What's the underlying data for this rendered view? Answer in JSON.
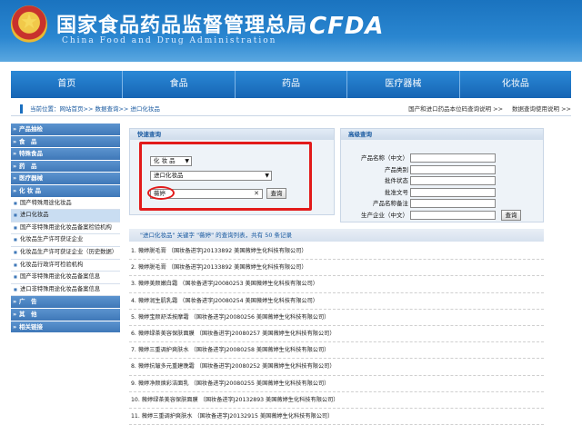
{
  "header": {
    "title": "国家食品药品监督管理总局",
    "subtitle": "China Food and Drug Administration",
    "logo_text": "CFDA",
    "emblem_icon": "national-emblem-icon"
  },
  "nav": [
    "首页",
    "食品",
    "药品",
    "医疗器械",
    "化妆品"
  ],
  "breadcrumb": {
    "text": "当前位置：网站首页>> 数据查询>> 进口化妆品",
    "links": [
      "国产和进口药品本位码查询说明 >>",
      "数据查询使用说明 >>"
    ]
  },
  "sidebar": {
    "categories_top": [
      "产品抽检",
      "食　品",
      "特殊食品",
      "药　品",
      "医疗器械",
      "化 妆 品"
    ],
    "sub_items": [
      {
        "label": "国产特殊用途化妆品",
        "active": false
      },
      {
        "label": "进口化妆品",
        "active": true
      },
      {
        "label": "国产非特殊用途化妆品备案检验机构",
        "active": false
      },
      {
        "label": "化妆品生产许可获证企业",
        "active": false
      },
      {
        "label": "化妆品生产许可获证企业（历史数据）",
        "active": false
      },
      {
        "label": "化妆品行政许可检验机构",
        "active": false
      },
      {
        "label": "国产非特殊用途化妆品备案信息",
        "active": false
      },
      {
        "label": "进口非特殊用途化妆品备案信息",
        "active": false
      }
    ],
    "categories_bottom": [
      "广　告",
      "其　他",
      "相关链接"
    ]
  },
  "quick_search": {
    "title": "快速查询",
    "select1": "化 妆 品",
    "select2": "进口化妆品",
    "input_value": "薇婷",
    "button": "查询"
  },
  "advanced_search": {
    "title": "高级查询",
    "fields": [
      "产品名称（中文）",
      "产品类别",
      "批件状态",
      "批准文号",
      "产品名称备注",
      "生产企业（中文）"
    ],
    "button": "查询"
  },
  "results": {
    "header": "\"进口化妆品\" 关键字 \"薇婷\" 的查询列表，共有 50 条记录",
    "rows": [
      "1. 薇婷脱毛膏 （国妆备进字J20133892 美国薇婷生化科技有限公司）",
      "2. 薇婷脱毛膏 （国妆备进字J20133892 美国薇婷生化科技有限公司）",
      "3. 薇婷美颜嫩白霜 （国妆备进字J20080253 美国薇婷生化科技有限公司）",
      "4. 薇婷润生肌乳霜 （国妆备进字J20080254 美国薇婷生化科技有限公司）",
      "5. 薇婷宝颜舒活按摩霜 （国妆备进字J20080256 美国薇婷生化科技有限公司）",
      "6. 薇婷绿茶美容保肤面膜 （国妆备进字J20080257 美国薇婷生化科技有限公司）",
      "7. 薇婷三重调护爽肤水 （国妆备进字J20080258 美国薇婷生化科技有限公司）",
      "8. 薇婷抗皱多元重建晚霜 （国妆备进字J20080252 美国薇婷生化科技有限公司）",
      "9. 薇婷净颜焕彩洁面乳 （国妆备进字J20080255 美国薇婷生化科技有限公司）",
      "10. 薇婷绿茶美容保肤面膜 （国妆备进字J20132893 美国薇婷生化科技有限公司）",
      "11. 薇婷三重调护爽肤水 （国妆备进字J20132915 美国薇婷生化科技有限公司）"
    ]
  },
  "colors": {
    "header_blue": "#1a73bf",
    "highlight_red": "#e21a1a"
  }
}
